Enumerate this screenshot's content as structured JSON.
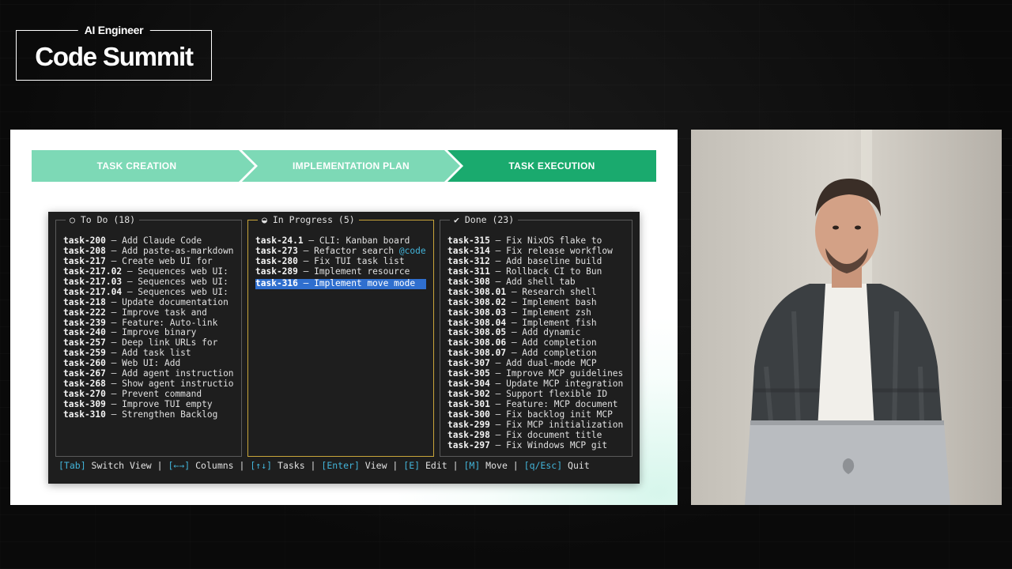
{
  "logo": {
    "top": "AI Engineer",
    "main": "Code Summit"
  },
  "stages": [
    {
      "label": "TASK CREATION",
      "color": "#7dd9b6"
    },
    {
      "label": "IMPLEMENTATION PLAN",
      "color": "#7dd9b6"
    },
    {
      "label": "TASK EXECUTION",
      "color": "#1aaa6e"
    }
  ],
  "kanban": {
    "todo": {
      "title": "○ To Do (18)",
      "items": [
        {
          "id": "task-200",
          "title": " – Add Claude Code"
        },
        {
          "id": "task-208",
          "title": " – Add paste-as-markdown"
        },
        {
          "id": "task-217",
          "title": " – Create web UI for"
        },
        {
          "id": "task-217.02",
          "title": " – Sequences web UI:"
        },
        {
          "id": "task-217.03",
          "title": " – Sequences web UI:"
        },
        {
          "id": "task-217.04",
          "title": " – Sequences web UI:"
        },
        {
          "id": "task-218",
          "title": " – Update documentation"
        },
        {
          "id": "task-222",
          "title": " – Improve task and"
        },
        {
          "id": "task-239",
          "title": " – Feature: Auto-link"
        },
        {
          "id": "task-240",
          "title": " – Improve binary"
        },
        {
          "id": "task-257",
          "title": " – Deep link URLs for"
        },
        {
          "id": "task-259",
          "title": " – Add task list"
        },
        {
          "id": "task-260",
          "title": " – Web UI: Add"
        },
        {
          "id": "task-267",
          "title": " – Add agent instruction"
        },
        {
          "id": "task-268",
          "title": " – Show agent instructio"
        },
        {
          "id": "task-270",
          "title": " – Prevent command"
        },
        {
          "id": "task-309",
          "title": " – Improve TUI empty"
        },
        {
          "id": "task-310",
          "title": " – Strengthen Backlog"
        }
      ]
    },
    "in_progress": {
      "title": "◒ In Progress (5)",
      "items": [
        {
          "id": "task-24.1",
          "title": " – CLI: Kanban board"
        },
        {
          "id": "task-273",
          "title": " – Refactor search ",
          "mention": "@code"
        },
        {
          "id": "task-280",
          "title": " – Fix TUI task list"
        },
        {
          "id": "task-289",
          "title": " – Implement resource"
        },
        {
          "id": "task-316",
          "title": " – Implement move mode",
          "selected": true
        }
      ]
    },
    "done": {
      "title": "✔ Done (23)",
      "items": [
        {
          "id": "task-315",
          "title": " – Fix NixOS flake to"
        },
        {
          "id": "task-314",
          "title": " – Fix release workflow"
        },
        {
          "id": "task-312",
          "title": " – Add baseline build"
        },
        {
          "id": "task-311",
          "title": " – Rollback CI to Bun"
        },
        {
          "id": "task-308",
          "title": " – Add shell tab"
        },
        {
          "id": "task-308.01",
          "title": " – Research shell"
        },
        {
          "id": "task-308.02",
          "title": " – Implement bash"
        },
        {
          "id": "task-308.03",
          "title": " – Implement zsh"
        },
        {
          "id": "task-308.04",
          "title": " – Implement fish"
        },
        {
          "id": "task-308.05",
          "title": " – Add dynamic"
        },
        {
          "id": "task-308.06",
          "title": " – Add completion"
        },
        {
          "id": "task-308.07",
          "title": " – Add completion"
        },
        {
          "id": "task-307",
          "title": " – Add dual-mode MCP"
        },
        {
          "id": "task-305",
          "title": " – Improve MCP guidelines"
        },
        {
          "id": "task-304",
          "title": " – Update MCP integration"
        },
        {
          "id": "task-302",
          "title": " – Support flexible ID"
        },
        {
          "id": "task-301",
          "title": " – Feature: MCP document"
        },
        {
          "id": "task-300",
          "title": " – Fix backlog init MCP"
        },
        {
          "id": "task-299",
          "title": " – Fix MCP initialization"
        },
        {
          "id": "task-298",
          "title": " – Fix document title"
        },
        {
          "id": "task-297",
          "title": " – Fix Windows MCP git"
        }
      ]
    }
  },
  "footer": [
    {
      "key": "[Tab]",
      "label": " Switch View"
    },
    {
      "key": "[←→]",
      "label": " Columns"
    },
    {
      "key": "[↑↓]",
      "label": " Tasks"
    },
    {
      "key": "[Enter]",
      "label": " View"
    },
    {
      "key": "[E]",
      "label": " Edit"
    },
    {
      "key": "[M]",
      "label": " Move"
    },
    {
      "key": "[q/Esc]",
      "label": " Quit"
    }
  ],
  "footer_separator": " | ",
  "colors": {
    "accent": "#42b3d8",
    "selected": "#2f6fcf",
    "in_progress_border": "#c8a53a"
  }
}
